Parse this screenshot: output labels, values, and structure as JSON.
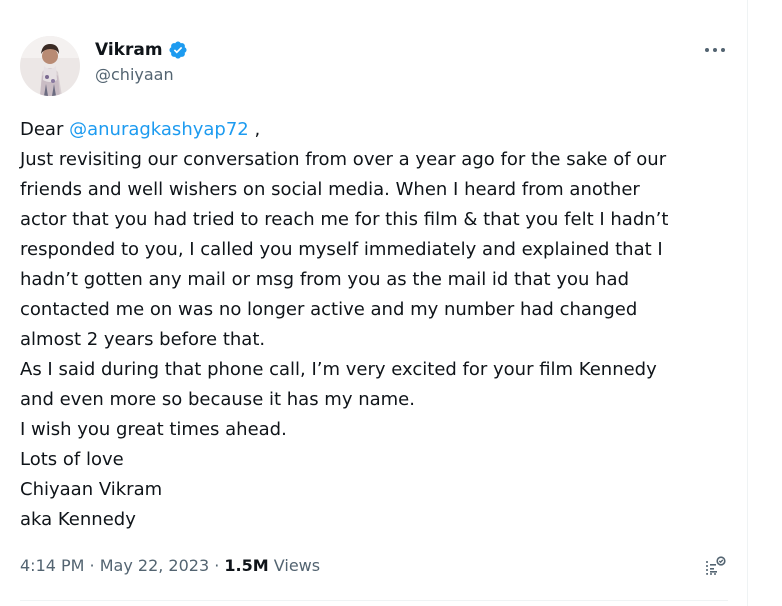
{
  "author": {
    "name": "Vikram",
    "handle": "@chiyaan",
    "verified_icon": "verified-badge-icon",
    "verified_color": "#1d9bf0"
  },
  "more_icon": "more-dots-icon",
  "tweet": {
    "greeting_prefix": "Dear ",
    "mention": "@anuragkashyap72",
    "greeting_suffix": " ,",
    "lines": [
      "Just revisiting our conversation from over a year ago for the sake of our",
      "friends and well wishers on social media. When I heard from another",
      "actor that you had tried to reach me for this film & that you felt I hadn’t",
      "responded to you, I called you myself immediately and explained that I",
      "hadn’t gotten any mail or msg from you as the mail id that you had",
      "contacted me on was no longer active and my number had changed",
      "almost 2 years before that.",
      "As I said during that phone call, I’m very excited for your film Kennedy",
      "and even more so because it has my name.",
      "I wish you great times ahead.",
      "Lots of love",
      "Chiyaan Vikram",
      "aka Kennedy"
    ]
  },
  "meta": {
    "time": "4:14 PM",
    "sep1": " · ",
    "date": "May 22, 2023",
    "sep2": " · ",
    "views_count": "1.5M",
    "views_label": " Views"
  },
  "analytics_icon": "analytics-icon",
  "colors": {
    "link": "#1d9bf0",
    "secondary_text": "#536471",
    "primary_text": "#0f1419",
    "divider": "#eff3f4"
  }
}
